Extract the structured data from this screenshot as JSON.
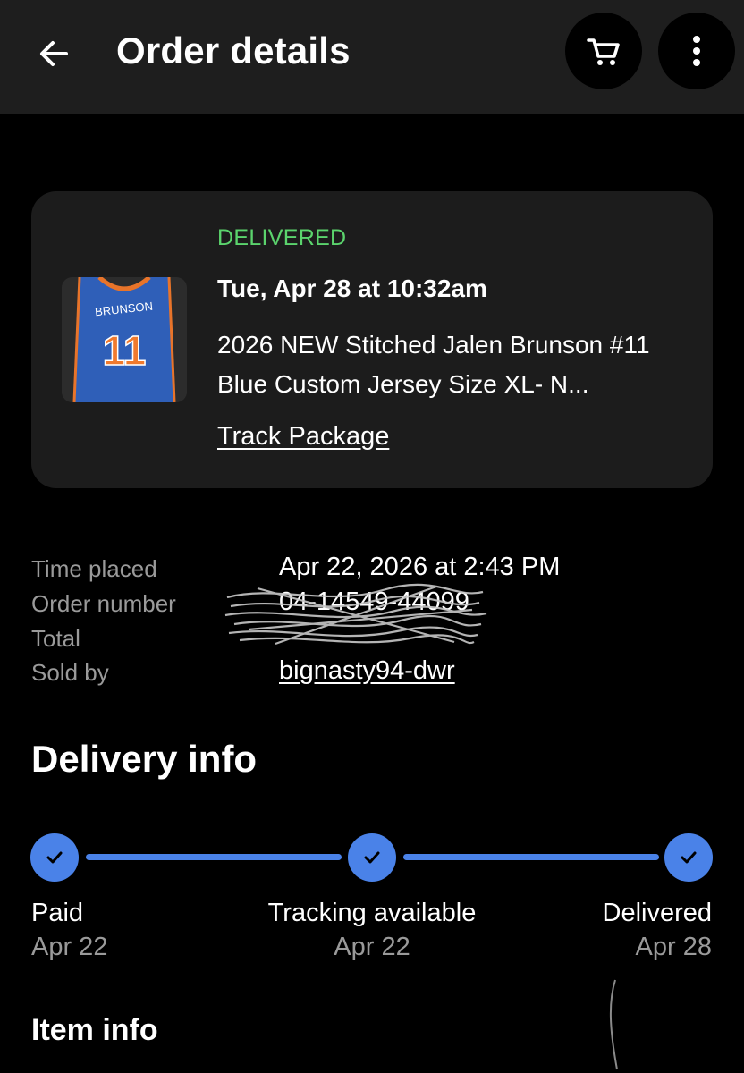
{
  "header": {
    "title": "Order details",
    "back_icon": "arrow-left-icon",
    "cart_icon": "shopping-cart-icon",
    "more_icon": "more-vertical-icon"
  },
  "order_card": {
    "status": "DELIVERED",
    "delivered_at": "Tue, Apr 28 at 10:32am",
    "item_title": "2026 NEW Stitched Jalen Brunson #11 Blue Custom Jersey Size XL- N...",
    "track_label": "Track Package",
    "thumbnail": {
      "jersey_name": "BRUNSON",
      "jersey_number": "11"
    }
  },
  "order_meta": {
    "rows": [
      {
        "label": "Time placed",
        "value": "Apr 22, 2026 at 2:43 PM"
      },
      {
        "label": "Order number",
        "value": "04-14549-44099"
      },
      {
        "label": "Total",
        "value": ""
      },
      {
        "label": "Sold by",
        "value": "bignasty94-dwr"
      }
    ]
  },
  "delivery": {
    "title": "Delivery info",
    "steps": [
      {
        "label": "Paid",
        "date": "Apr 22",
        "done": true
      },
      {
        "label": "Tracking available",
        "date": "Apr 22",
        "done": true
      },
      {
        "label": "Delivered",
        "date": "Apr 28",
        "done": true
      }
    ]
  },
  "item_info": {
    "title": "Item info"
  },
  "colors": {
    "background": "#000000",
    "header_bg": "#1e1e1e",
    "card_bg": "#1c1c1c",
    "status_green": "#5bd46d",
    "progress_blue": "#4a82e8",
    "muted_text": "#9a9a9a"
  }
}
